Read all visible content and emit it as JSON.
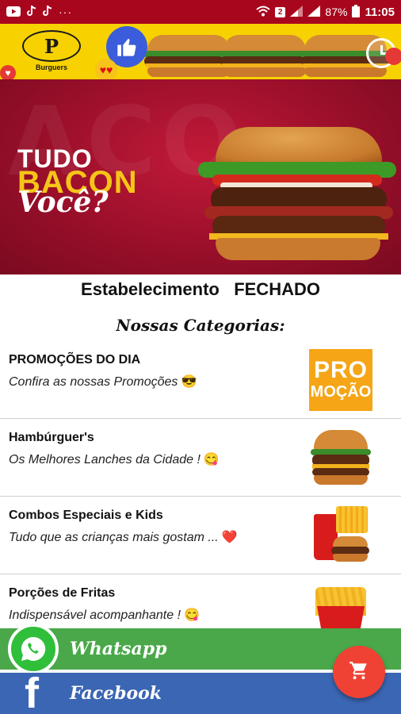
{
  "status_bar": {
    "time": "11:05",
    "battery": "87%",
    "sim_badge": "2",
    "more": "···"
  },
  "header": {
    "logo_letter": "P",
    "logo_text": "Burguers"
  },
  "hero": {
    "line1": "TUDO",
    "line2": "BACON",
    "line3": "Você?",
    "watermark": "ACON"
  },
  "store": {
    "status_text": "Estabelecimento   FECHADO"
  },
  "categories": {
    "title": "Nossas Categorias:",
    "items": [
      {
        "name": "PROMOÇÕES DO DIA",
        "description": "Confira as nossas Promoções",
        "emoji": "😎",
        "thumb_line1": "PRO",
        "thumb_line2": "MOÇÃO"
      },
      {
        "name": "Hambúrguer's",
        "description": "Os Melhores Lanches da Cidade !",
        "emoji": "😋"
      },
      {
        "name": "Combos Especiais e Kids",
        "description": "Tudo que as crianças mais gostam ...",
        "emoji": "❤️"
      },
      {
        "name": "Porções de Fritas",
        "description": "Indispensável acompanhante !",
        "emoji": "😋"
      }
    ]
  },
  "actions": {
    "whatsapp_label": "Whatsapp",
    "facebook_label": "Facebook",
    "facebook_glyph": "f"
  },
  "colors": {
    "status_bar": "#a8061d",
    "header_yellow": "#f7d200",
    "hero_red": "#9a0f2a",
    "whatsapp_green": "#4aa84a",
    "facebook_blue": "#3b66b3",
    "fab_red": "#ef4234",
    "promo_orange": "#f5a516"
  },
  "icons": {
    "youtube": "youtube-icon",
    "tiktok": "tiktok-icon",
    "wifi": "wifi-icon",
    "signal": "signal-icon",
    "battery": "battery-icon",
    "like": "thumbs-up-icon",
    "clock": "clock-icon",
    "whatsapp": "whatsapp-icon",
    "facebook": "facebook-icon",
    "cart": "cart-icon"
  }
}
